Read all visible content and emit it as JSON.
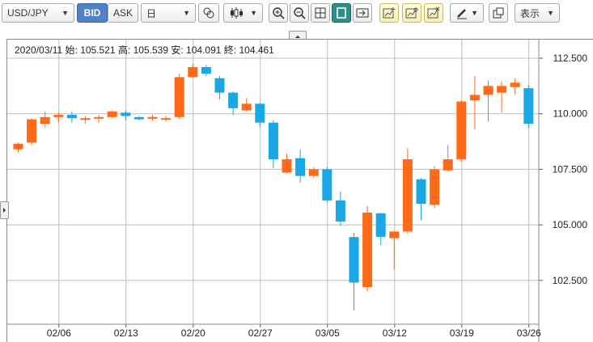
{
  "toolbar": {
    "symbol": "USD/JPY",
    "bid_label": "BID",
    "ask_label": "ASK",
    "period": "日",
    "display_label": "表示",
    "accent_color": "#4f82c6"
  },
  "info": {
    "date": "2020/03/11",
    "open_label": "始:",
    "open": "105.521",
    "high_label": "高:",
    "high": "105.539",
    "low_label": "安:",
    "low": "104.091",
    "close_label": "終:",
    "close": "104.461"
  },
  "chart_data": {
    "type": "candlestick",
    "title": "",
    "ylim": [
      100.6,
      112.9
    ],
    "y_ticks": [
      "112.500",
      "110.000",
      "107.500",
      "105.000",
      "102.500"
    ],
    "x_ticks": [
      "02/06",
      "02/13",
      "02/20",
      "02/27",
      "03/05",
      "03/12",
      "03/19",
      "03/26"
    ],
    "grid": true,
    "colors": {
      "up": "#ff6a1a",
      "down": "#1aa7e6"
    },
    "candles": [
      {
        "open": 108.4,
        "high": 108.7,
        "low": 108.25,
        "close": 108.65
      },
      {
        "open": 108.7,
        "high": 109.8,
        "low": 108.6,
        "close": 109.75
      },
      {
        "open": 109.55,
        "high": 110.1,
        "low": 109.4,
        "close": 109.85
      },
      {
        "open": 109.85,
        "high": 110.05,
        "low": 109.6,
        "close": 109.95
      },
      {
        "open": 109.95,
        "high": 110.1,
        "low": 109.6,
        "close": 109.8
      },
      {
        "open": 109.75,
        "high": 109.9,
        "low": 109.55,
        "close": 109.8
      },
      {
        "open": 109.8,
        "high": 109.95,
        "low": 109.6,
        "close": 109.85
      },
      {
        "open": 109.85,
        "high": 110.15,
        "low": 109.8,
        "close": 110.1
      },
      {
        "open": 110.05,
        "high": 110.15,
        "low": 109.7,
        "close": 109.9
      },
      {
        "open": 109.85,
        "high": 109.9,
        "low": 109.7,
        "close": 109.75
      },
      {
        "open": 109.8,
        "high": 109.95,
        "low": 109.7,
        "close": 109.85
      },
      {
        "open": 109.8,
        "high": 109.9,
        "low": 109.65,
        "close": 109.8
      },
      {
        "open": 109.85,
        "high": 111.8,
        "low": 109.75,
        "close": 111.65
      },
      {
        "open": 111.65,
        "high": 112.25,
        "low": 111.6,
        "close": 112.1
      },
      {
        "open": 112.1,
        "high": 112.2,
        "low": 111.7,
        "close": 111.8
      },
      {
        "open": 111.6,
        "high": 111.7,
        "low": 110.65,
        "close": 110.95
      },
      {
        "open": 110.95,
        "high": 111.0,
        "low": 109.95,
        "close": 110.25
      },
      {
        "open": 110.15,
        "high": 110.7,
        "low": 110.1,
        "close": 110.45
      },
      {
        "open": 110.45,
        "high": 110.5,
        "low": 109.4,
        "close": 109.6
      },
      {
        "open": 109.6,
        "high": 109.7,
        "low": 107.55,
        "close": 107.95
      },
      {
        "open": 107.35,
        "high": 108.2,
        "low": 107.3,
        "close": 107.95
      },
      {
        "open": 108.0,
        "high": 108.4,
        "low": 106.9,
        "close": 107.2
      },
      {
        "open": 107.2,
        "high": 107.6,
        "low": 107.1,
        "close": 107.5
      },
      {
        "open": 107.5,
        "high": 107.6,
        "low": 106.0,
        "close": 106.1
      },
      {
        "open": 106.1,
        "high": 106.5,
        "low": 104.95,
        "close": 105.15
      },
      {
        "open": 104.45,
        "high": 104.65,
        "low": 101.15,
        "close": 102.4
      },
      {
        "open": 102.2,
        "high": 105.85,
        "low": 102.0,
        "close": 105.55
      },
      {
        "open": 105.521,
        "high": 105.539,
        "low": 104.091,
        "close": 104.461
      },
      {
        "open": 104.4,
        "high": 104.7,
        "low": 103.0,
        "close": 104.7
      },
      {
        "open": 104.7,
        "high": 108.45,
        "low": 104.6,
        "close": 107.95
      },
      {
        "open": 107.05,
        "high": 107.1,
        "low": 105.2,
        "close": 105.95
      },
      {
        "open": 105.9,
        "high": 107.65,
        "low": 105.75,
        "close": 107.5
      },
      {
        "open": 107.45,
        "high": 108.6,
        "low": 107.4,
        "close": 107.95
      },
      {
        "open": 107.95,
        "high": 110.6,
        "low": 107.85,
        "close": 110.55
      },
      {
        "open": 110.6,
        "high": 111.7,
        "low": 109.3,
        "close": 110.85
      },
      {
        "open": 110.85,
        "high": 111.5,
        "low": 109.65,
        "close": 111.25
      },
      {
        "open": 110.95,
        "high": 111.45,
        "low": 110.05,
        "close": 111.25
      },
      {
        "open": 111.2,
        "high": 111.6,
        "low": 110.85,
        "close": 111.4
      },
      {
        "open": 111.15,
        "high": 111.3,
        "low": 109.35,
        "close": 109.55
      }
    ]
  }
}
